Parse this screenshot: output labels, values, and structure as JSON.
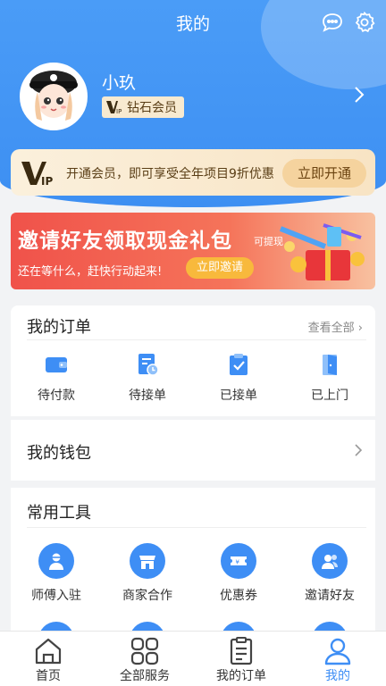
{
  "header": {
    "title": "我的",
    "icons": [
      "message-icon",
      "settings-icon"
    ]
  },
  "profile": {
    "name": "小玖",
    "membership": "钻石会员"
  },
  "vip_banner": {
    "text": "开通会员，即可享受全年项目9折优惠",
    "button": "立即开通"
  },
  "invite_banner": {
    "title": "邀请好友领取现金礼包",
    "title_tag": "可提现",
    "subtitle": "还在等什么，赶快行动起来!",
    "button": "立即邀请"
  },
  "orders": {
    "title": "我的订单",
    "view_all": "查看全部",
    "items": [
      {
        "label": "待付款",
        "icon": "wallet-icon"
      },
      {
        "label": "待接单",
        "icon": "pending-order-icon"
      },
      {
        "label": "已接单",
        "icon": "accepted-order-icon"
      },
      {
        "label": "已上门",
        "icon": "door-icon"
      }
    ]
  },
  "wallet": {
    "title": "我的钱包"
  },
  "tools": {
    "title": "常用工具",
    "items": [
      {
        "label": "师傅入驻",
        "icon": "worker-icon"
      },
      {
        "label": "商家合作",
        "icon": "store-icon"
      },
      {
        "label": "优惠券",
        "icon": "coupon-icon"
      },
      {
        "label": "邀请好友",
        "icon": "invite-friends-icon"
      }
    ]
  },
  "tabbar": {
    "items": [
      {
        "label": "首页",
        "icon": "home-icon"
      },
      {
        "label": "全部服务",
        "icon": "grid-icon"
      },
      {
        "label": "我的订单",
        "icon": "order-list-icon"
      },
      {
        "label": "我的",
        "icon": "user-icon"
      }
    ],
    "active_index": 3
  },
  "colors": {
    "primary": "#3e8ef5",
    "vip_gold": "#f5d39e",
    "invite_red": "#f0524a"
  }
}
